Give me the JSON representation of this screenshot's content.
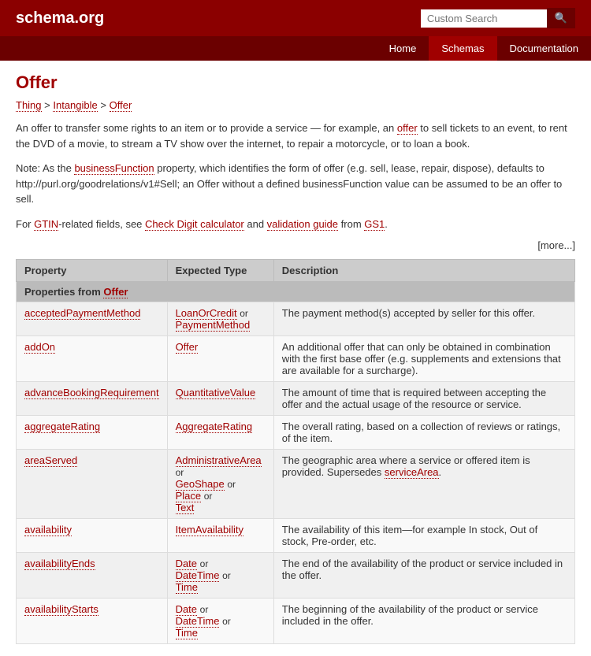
{
  "header": {
    "logo": "schema.org",
    "search_placeholder": "Custom Search",
    "search_btn_icon": "🔍"
  },
  "navbar": {
    "items": [
      {
        "label": "Home",
        "active": false
      },
      {
        "label": "Schemas",
        "active": true
      },
      {
        "label": "Documentation",
        "active": false
      }
    ]
  },
  "page": {
    "title": "Offer",
    "breadcrumb": [
      {
        "label": "Thing",
        "href": "#"
      },
      {
        "label": "Intangible",
        "href": "#"
      },
      {
        "label": "Offer",
        "href": "#",
        "current": true
      }
    ],
    "description": "An offer to transfer some rights to an item or to provide a service — for example, an offer to sell tickets to an event, to rent the DVD of a movie, to stream a TV show over the internet, to repair a motorcycle, or to loan a book.",
    "note": "Note: As the businessFunction property, which identifies the form of offer (e.g. sell, lease, repair, dispose), defaults to http://purl.org/goodrelations/v1#Sell; an Offer without a defined businessFunction value can be assumed to be an offer to sell.",
    "gtin_note": "For GTIN-related fields, see Check Digit calculator and validation guide from GS1.",
    "more_link": "[more...]",
    "table": {
      "columns": [
        "Property",
        "Expected Type",
        "Description"
      ],
      "section_header": "Properties from Offer",
      "rows": [
        {
          "property": "acceptedPaymentMethod",
          "types": [
            {
              "label": "LoanOrCredit",
              "or": true
            },
            {
              "label": "PaymentMethod",
              "or": false
            }
          ],
          "description": "The payment method(s) accepted by seller for this offer."
        },
        {
          "property": "addOn",
          "types": [
            {
              "label": "Offer",
              "or": false
            }
          ],
          "description": "An additional offer that can only be obtained in combination with the first base offer (e.g. supplements and extensions that are available for a surcharge)."
        },
        {
          "property": "advanceBookingRequirement",
          "types": [
            {
              "label": "QuantitativeValue",
              "or": false
            }
          ],
          "description": "The amount of time that is required between accepting the offer and the actual usage of the resource or service."
        },
        {
          "property": "aggregateRating",
          "types": [
            {
              "label": "AggregateRating",
              "or": false
            }
          ],
          "description": "The overall rating, based on a collection of reviews or ratings, of the item."
        },
        {
          "property": "areaServed",
          "types": [
            {
              "label": "AdministrativeArea",
              "or": true
            },
            {
              "label": "GeoShape",
              "or": true
            },
            {
              "label": "Place",
              "or": true
            },
            {
              "label": "Text",
              "or": false
            }
          ],
          "description": "The geographic area where a service or offered item is provided. Supersedes serviceArea."
        },
        {
          "property": "availability",
          "types": [
            {
              "label": "ItemAvailability",
              "or": false
            }
          ],
          "description": "The availability of this item—for example In stock, Out of stock, Pre-order, etc."
        },
        {
          "property": "availabilityEnds",
          "types": [
            {
              "label": "Date",
              "or": true
            },
            {
              "label": "DateTime",
              "or": true
            },
            {
              "label": "Time",
              "or": false
            }
          ],
          "description": "The end of the availability of the product or service included in the offer."
        },
        {
          "property": "availabilityStarts",
          "types": [
            {
              "label": "Date",
              "or": true
            },
            {
              "label": "DateTime",
              "or": true
            },
            {
              "label": "Time",
              "or": false
            }
          ],
          "description": "The beginning of the availability of the product or service included in the offer."
        }
      ]
    }
  }
}
